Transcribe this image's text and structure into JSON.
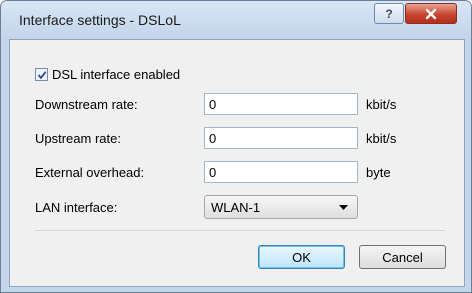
{
  "window": {
    "title": "Interface settings - DSLoL",
    "help_glyph": "?",
    "close_glyph": "×"
  },
  "form": {
    "dsl_enabled": {
      "label": "DSL interface enabled",
      "checked": true
    },
    "downstream": {
      "label": "Downstream rate:",
      "value": "0",
      "unit": "kbit/s"
    },
    "upstream": {
      "label": "Upstream rate:",
      "value": "0",
      "unit": "kbit/s"
    },
    "overhead": {
      "label": "External overhead:",
      "value": "0",
      "unit": "byte"
    },
    "lan_interface": {
      "label": "LAN interface:",
      "selected": "WLAN-1"
    }
  },
  "buttons": {
    "ok": "OK",
    "cancel": "Cancel"
  },
  "icons": {
    "check": "check-icon",
    "dropdown": "chevron-down-icon",
    "help": "help-icon",
    "close": "close-icon"
  }
}
